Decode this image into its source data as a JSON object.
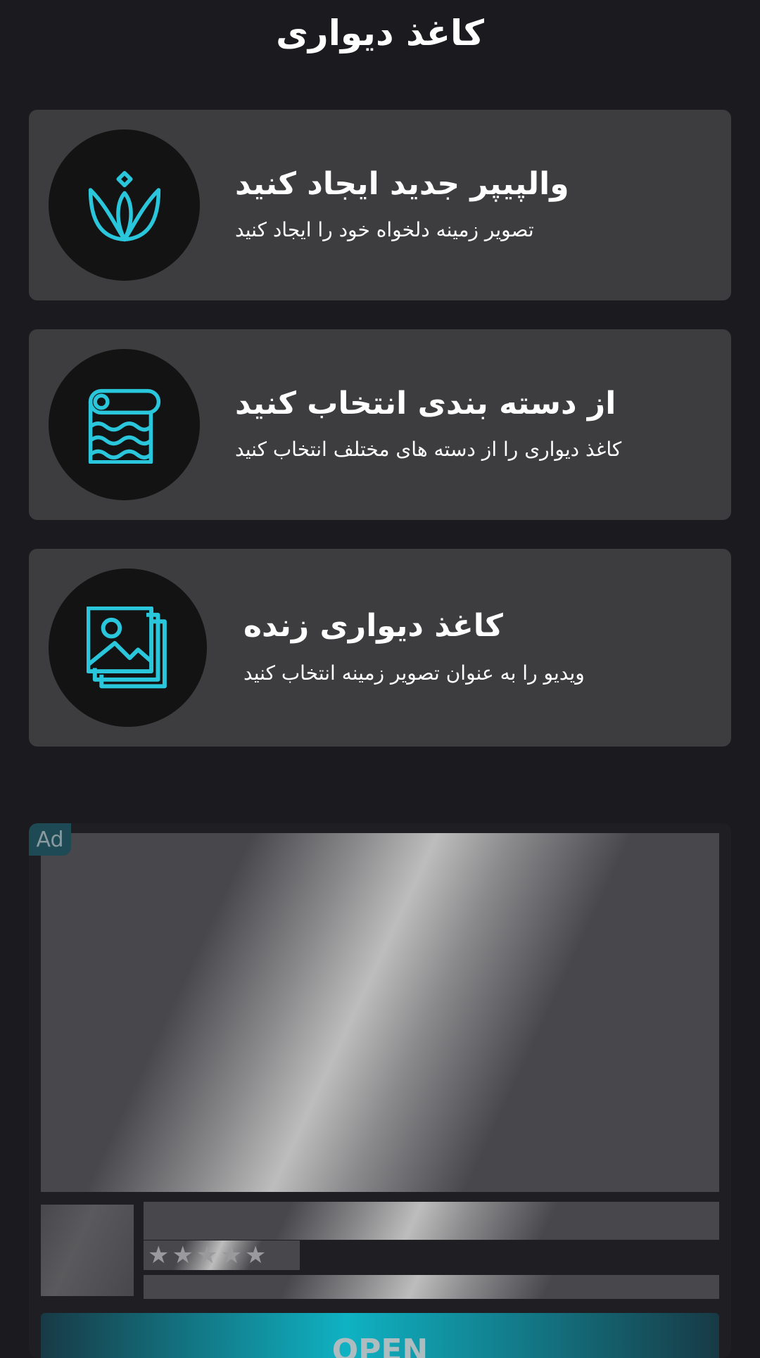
{
  "header": {
    "title": "کاغذ دیواری"
  },
  "cards": [
    {
      "title": "والپیپر جدید ایجاد کنید",
      "subtitle": "تصویر زمینه دلخواه خود را ایجاد کنید",
      "icon": "tulip-icon"
    },
    {
      "title": "از دسته بندی انتخاب کنید",
      "subtitle": "کاغذ دیواری را از دسته های مختلف انتخاب کنید",
      "icon": "wallpaper-roll-icon"
    },
    {
      "title": "کاغذ دیواری زنده",
      "subtitle": "ویدیو را به عنوان تصویر زمینه انتخاب کنید",
      "icon": "image-stack-icon"
    }
  ],
  "ad": {
    "badge": "Ad",
    "stars": "★★★★★",
    "cta": "OPEN"
  },
  "colors": {
    "accent": "#29c6dc",
    "background": "#1b1a1f",
    "card": "#3d3c3e",
    "icon_circle": "#131313"
  }
}
